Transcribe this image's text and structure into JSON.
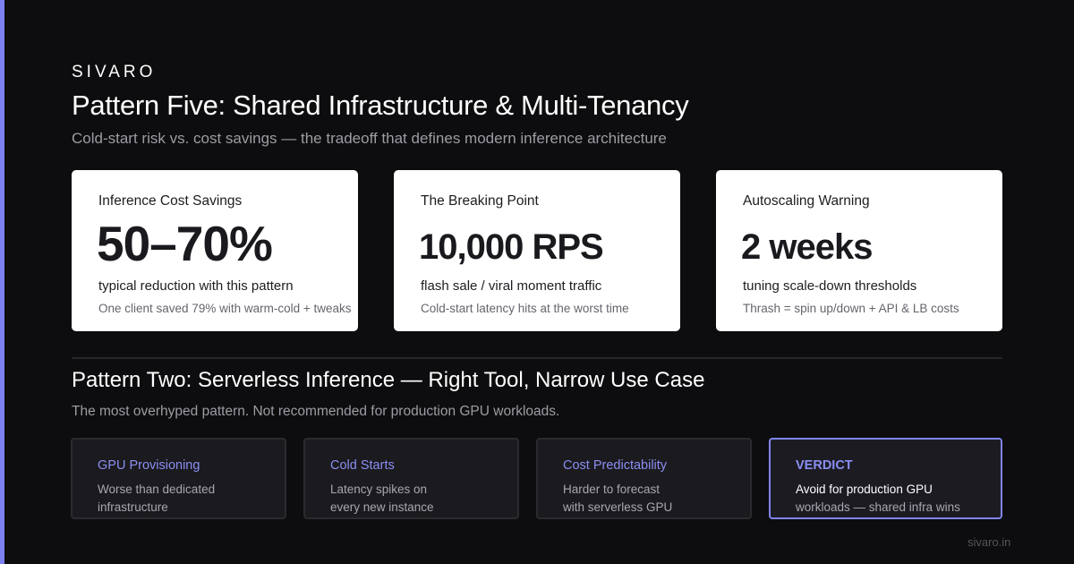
{
  "header": {
    "brand": "SIVARO",
    "title": "Pattern Five: Shared Infrastructure & Multi-Tenancy",
    "subtitle": "Cold-start risk vs. cost savings — the tradeoff that defines modern inference architecture"
  },
  "stats": [
    {
      "label": "Inference Cost Savings",
      "value": "50–70%",
      "desc": "typical reduction with this pattern",
      "note": "One client saved 79% with warm-cold + tweaks"
    },
    {
      "label": "The Breaking Point",
      "value": "10,000 RPS",
      "desc": "flash sale / viral moment traffic",
      "note": "Cold-start latency hits at the worst time"
    },
    {
      "label": "Autoscaling Warning",
      "value": "2 weeks",
      "desc": "tuning scale-down thresholds",
      "note": "Thrash = spin up/down + API & LB costs"
    }
  ],
  "section": {
    "title": "Pattern Two: Serverless Inference — Right Tool, Narrow Use Case",
    "subtitle": "The most overhyped pattern. Not recommended for production GPU workloads."
  },
  "tiles": [
    {
      "head": "GPU Provisioning",
      "line1": "Worse than dedicated",
      "line2": "infrastructure"
    },
    {
      "head": "Cold Starts",
      "line1": "Latency spikes on",
      "line2": "every new instance"
    },
    {
      "head": "Cost Predictability",
      "line1": "Harder to forecast",
      "line2": "with serverless GPU"
    },
    {
      "head": "VERDICT",
      "line1": "Avoid for production GPU",
      "line2": "workloads — shared infra wins"
    }
  ],
  "footer": {
    "url": "sivaro.in"
  },
  "colors": {
    "accent": "#7b82f0",
    "background": "#0d0c0e",
    "card": "#ffffff"
  }
}
